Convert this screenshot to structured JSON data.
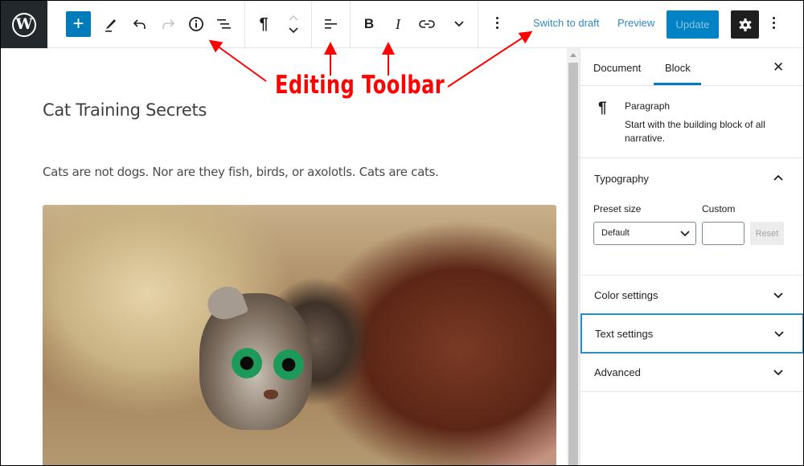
{
  "toolbar": {
    "logo_icon": "wordpress-logo-icon",
    "add_block_icon": "plus-icon",
    "add_block_glyph": "+",
    "tools": [
      "edit-pencil-icon",
      "undo-icon",
      "redo-icon",
      "info-icon",
      "list-view-icon"
    ],
    "block_type_icon": "pilcrow-icon",
    "block_type_glyph": "¶",
    "move_icons": [
      "chevron-up-icon",
      "chevron-down-icon"
    ],
    "align_icon": "align-left-icon",
    "format_icons": [
      "bold-icon",
      "italic-icon",
      "link-icon",
      "more-chevron-icon"
    ],
    "bold_glyph": "B",
    "italic_glyph": "I",
    "switch_to_draft": "Switch to draft",
    "preview": "Preview",
    "update": "Update",
    "settings_icon": "gear-icon",
    "more_icon": "kebab-icon"
  },
  "editor": {
    "post_title": "Cat Training Secrets",
    "paragraph": "Cats are not dogs. Nor are they fish, birds, or axolotls. Cats are cats.",
    "image_alt": "Tabby kitten with green eyes peeking out from under a shaggy brown and pink blanket"
  },
  "sidebar": {
    "tabs": [
      {
        "label": "Document",
        "active": false
      },
      {
        "label": "Block",
        "active": true
      }
    ],
    "close_glyph": "✕",
    "block_card": {
      "icon_glyph": "¶",
      "name": "Paragraph",
      "description": "Start with the building block of all narrative."
    },
    "typography": {
      "title": "Typography",
      "expanded": true,
      "preset_label": "Preset size",
      "preset_value": "Default",
      "custom_label": "Custom",
      "custom_value": "",
      "reset_label": "Reset"
    },
    "panels": [
      {
        "title": "Color settings",
        "expanded": false
      },
      {
        "title": "Text settings",
        "expanded": false,
        "focused": true
      },
      {
        "title": "Advanced",
        "expanded": false
      }
    ]
  },
  "annotation": {
    "label": "Editing Toolbar",
    "color": "#ff0000"
  },
  "colors": {
    "accent": "#007cba",
    "link": "#2e8ac4",
    "dark": "#1e1e1e",
    "logo_bg": "#23282d"
  }
}
